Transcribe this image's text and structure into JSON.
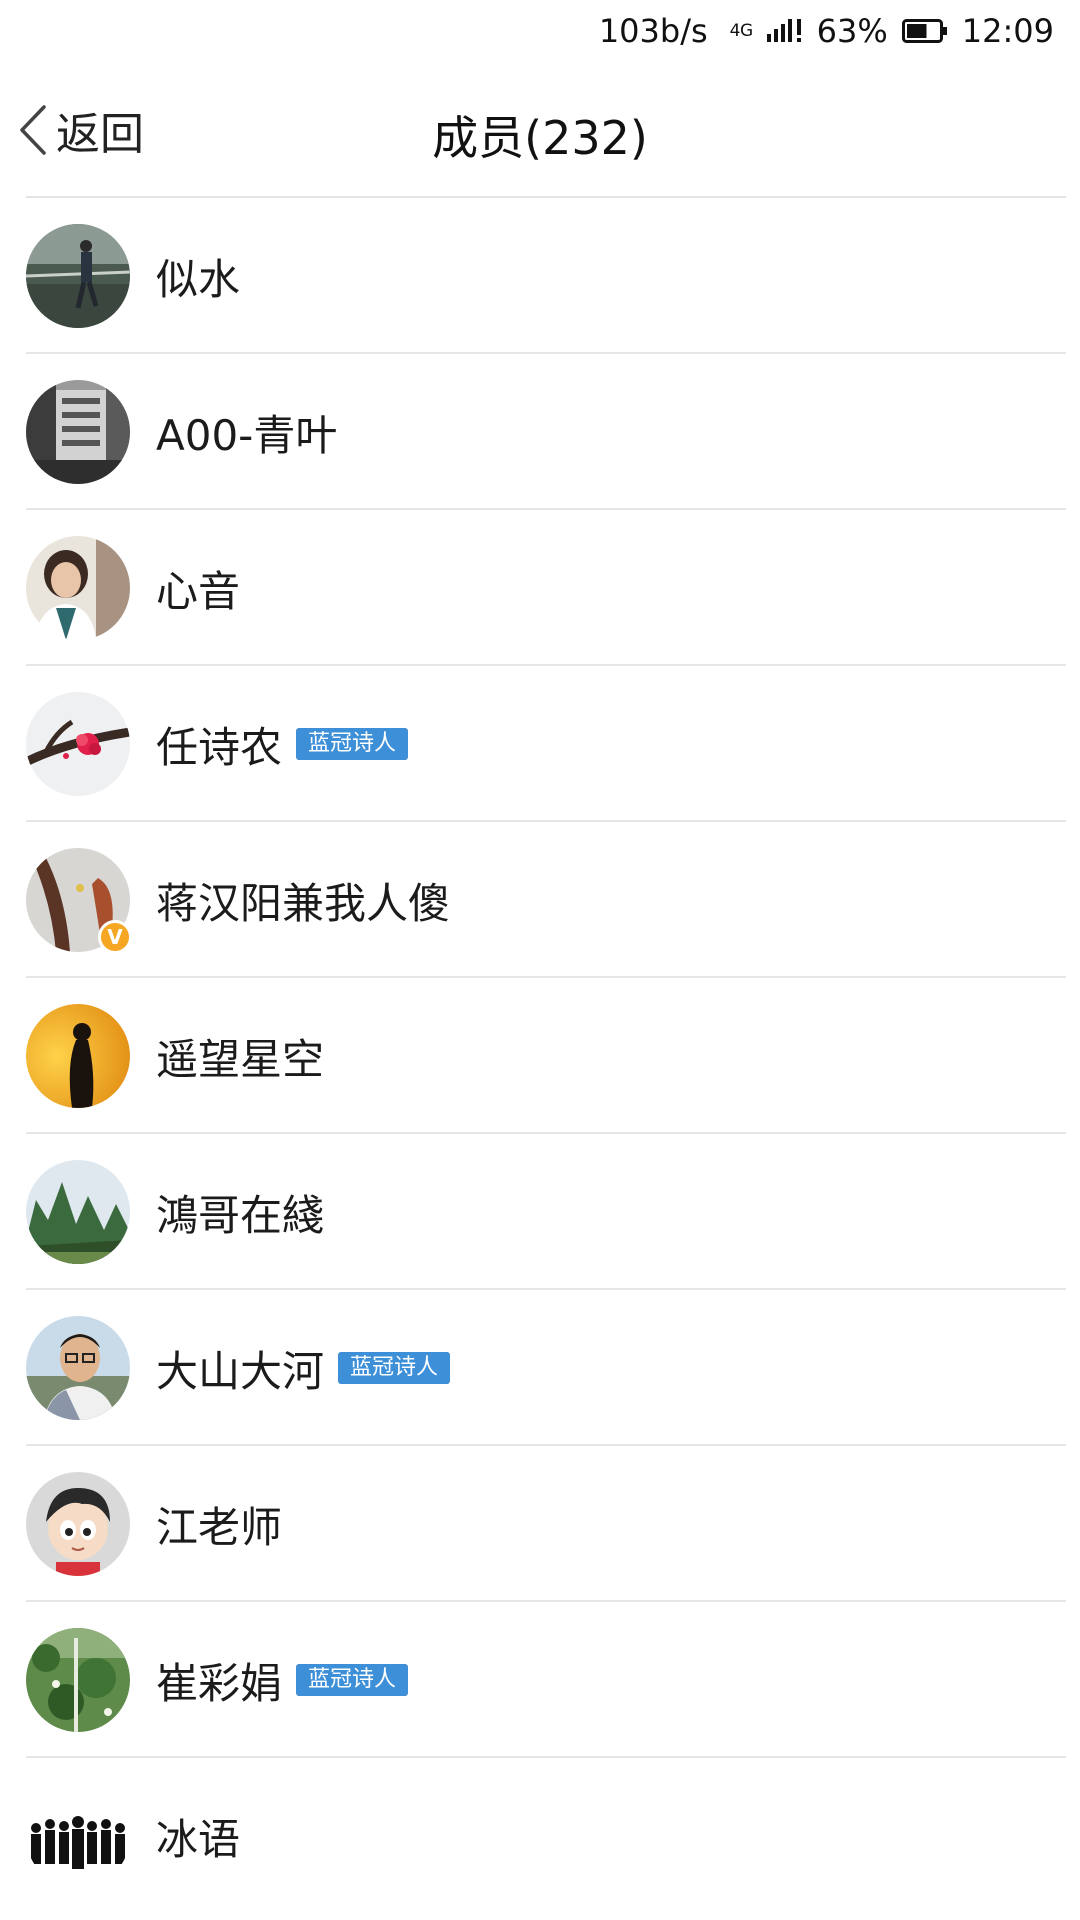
{
  "status_bar": {
    "net_speed": "103b/s",
    "network_type": "4G",
    "battery_percent": "63%",
    "battery_level": 0.63,
    "time": "12:09",
    "icons": [
      "signal-icon",
      "alert-icon",
      "battery-icon"
    ]
  },
  "nav": {
    "back_label": "返回",
    "title": "成员(232)"
  },
  "members": [
    {
      "name": "似水",
      "tag": "",
      "verified": false,
      "avatar": "runner-road-photo"
    },
    {
      "name": "A00-青叶",
      "tag": "",
      "verified": false,
      "avatar": "building-bw-photo"
    },
    {
      "name": "心音",
      "tag": "",
      "verified": false,
      "avatar": "woman-portrait-photo"
    },
    {
      "name": "任诗农",
      "tag": "蓝冠诗人",
      "verified": false,
      "avatar": "plum-blossom-photo"
    },
    {
      "name": "蒋汉阳兼我人傻",
      "tag": "",
      "verified": true,
      "verified_mark": "V",
      "avatar": "branch-photo"
    },
    {
      "name": "遥望星空",
      "tag": "",
      "verified": false,
      "avatar": "silhouette-sunset-photo"
    },
    {
      "name": "鴻哥在綫",
      "tag": "",
      "verified": false,
      "avatar": "karst-mountains-photo"
    },
    {
      "name": "大山大河",
      "tag": "蓝冠诗人",
      "verified": false,
      "avatar": "man-glasses-photo"
    },
    {
      "name": "江老师",
      "tag": "",
      "verified": false,
      "avatar": "cartoon-boy-avatar"
    },
    {
      "name": "崔彩娟",
      "tag": "蓝冠诗人",
      "verified": false,
      "avatar": "green-plants-photo"
    },
    {
      "name": "冰语",
      "tag": "",
      "verified": false,
      "avatar": "crowd-silhouette-photo"
    }
  ],
  "colors": {
    "tag_bg": "#3d8fd8",
    "verified_badge": "#f5a623",
    "divider": "#e7e7e7"
  }
}
